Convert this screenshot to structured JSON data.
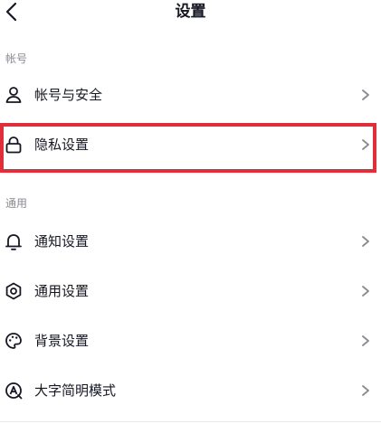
{
  "header": {
    "title": "设置",
    "back_icon": "chevron-left-icon"
  },
  "sections": [
    {
      "label": "帐号",
      "items": [
        {
          "label": "帐号与安全",
          "icon": "user-icon"
        },
        {
          "label": "隐私设置",
          "icon": "lock-icon",
          "highlighted": true
        }
      ]
    },
    {
      "label": "通用",
      "items": [
        {
          "label": "通知设置",
          "icon": "bell-icon"
        },
        {
          "label": "通用设置",
          "icon": "gear-icon"
        },
        {
          "label": "背景设置",
          "icon": "palette-icon"
        },
        {
          "label": "大字简明模式",
          "icon": "font-a-icon"
        }
      ]
    }
  ],
  "colors": {
    "text": "#161823",
    "section_label": "#8a8b91",
    "highlight": "#e02f3a",
    "chevron": "#8a8b91"
  }
}
